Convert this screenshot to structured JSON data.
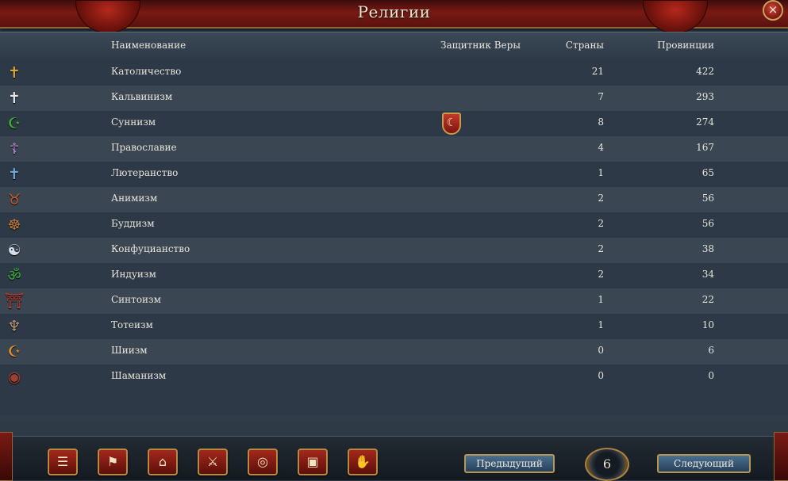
{
  "window": {
    "title": "Религии",
    "close_icon": "×"
  },
  "columns": {
    "name": "Наименование",
    "defender": "Защитник Веры",
    "countries": "Страны",
    "provinces": "Провинции"
  },
  "religions": [
    {
      "icon": "✝",
      "icon_name": "catholic-cross-icon",
      "color": "#d9a33a",
      "name": "Католичество",
      "countries": "21",
      "provinces": "422"
    },
    {
      "icon": "✝",
      "icon_name": "reformed-cross-icon",
      "color": "#e6e6e6",
      "name": "Кальвинизм",
      "countries": "7",
      "provinces": "293"
    },
    {
      "icon": "☪",
      "icon_name": "crescent-icon",
      "color": "#3fa63a",
      "name": "Суннизм",
      "countries": "8",
      "provinces": "274",
      "defender_icon": "☾"
    },
    {
      "icon": "☦",
      "icon_name": "orthodox-cross-icon",
      "color": "#b98ad9",
      "name": "Православие",
      "countries": "4",
      "provinces": "167"
    },
    {
      "icon": "✝",
      "icon_name": "protestant-cross-icon",
      "color": "#6fa7d6",
      "name": "Лютеранство",
      "countries": "1",
      "provinces": "65"
    },
    {
      "icon": "♉",
      "icon_name": "animal-icon",
      "color": "#c45a2a",
      "name": "Анимизм",
      "countries": "2",
      "provinces": "56"
    },
    {
      "icon": "☸",
      "icon_name": "dharma-wheel-icon",
      "color": "#c27a3a",
      "name": "Буддизм",
      "countries": "2",
      "provinces": "56"
    },
    {
      "icon": "☯",
      "icon_name": "yin-yang-icon",
      "color": "#d8dde6",
      "name": "Конфуцианство",
      "countries": "2",
      "provinces": "38"
    },
    {
      "icon": "ॐ",
      "icon_name": "om-icon",
      "color": "#3aa63a",
      "name": "Индуизм",
      "countries": "2",
      "provinces": "34"
    },
    {
      "icon": "⛩",
      "icon_name": "torii-gate-icon",
      "color": "#c43a2a",
      "name": "Синтоизм",
      "countries": "1",
      "provinces": "22"
    },
    {
      "icon": "♆",
      "icon_name": "totem-icon",
      "color": "#b99a7a",
      "name": "Тотеизм",
      "countries": "1",
      "provinces": "10"
    },
    {
      "icon": "☪",
      "icon_name": "shia-crescent-icon",
      "color": "#d98a2a",
      "name": "Шиизм",
      "countries": "0",
      "provinces": "6"
    },
    {
      "icon": "◉",
      "icon_name": "shaman-icon",
      "color": "#a04030",
      "name": "Шаманизм",
      "countries": "0",
      "provinces": "0"
    }
  ],
  "bottom_bar": {
    "buttons": [
      {
        "icon": "☰",
        "icon_name": "ledger-icon"
      },
      {
        "icon": "⚑",
        "icon_name": "flag-icon"
      },
      {
        "icon": "⌂",
        "icon_name": "buildings-icon"
      },
      {
        "icon": "⚔",
        "icon_name": "swords-icon"
      },
      {
        "icon": "◎",
        "icon_name": "coins-icon"
      },
      {
        "icon": "▣",
        "icon_name": "chest-icon"
      },
      {
        "icon": "✋",
        "icon_name": "handshake-icon"
      }
    ],
    "prev_label": "Предыдущий",
    "page_number": "6",
    "next_label": "Следующий"
  }
}
